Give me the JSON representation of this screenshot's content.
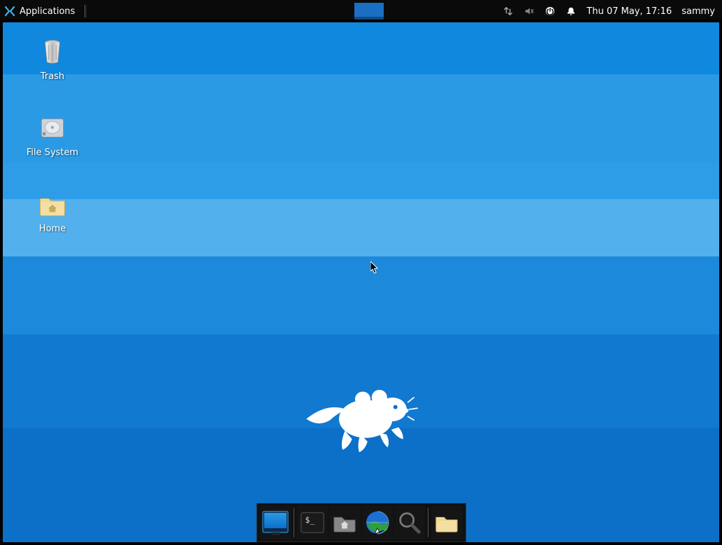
{
  "panel": {
    "applications_label": "Applications",
    "datetime": "Thu 07 May, 17:16",
    "username": "sammy"
  },
  "desktop": {
    "icons": [
      {
        "id": "trash",
        "label": "Trash"
      },
      {
        "id": "filesystem",
        "label": "File System"
      },
      {
        "id": "home",
        "label": "Home"
      }
    ]
  },
  "dock": {
    "items": [
      {
        "id": "show-desktop"
      },
      {
        "id": "terminal"
      },
      {
        "id": "file-manager"
      },
      {
        "id": "web-browser"
      },
      {
        "id": "app-finder"
      },
      {
        "id": "folder"
      }
    ]
  }
}
